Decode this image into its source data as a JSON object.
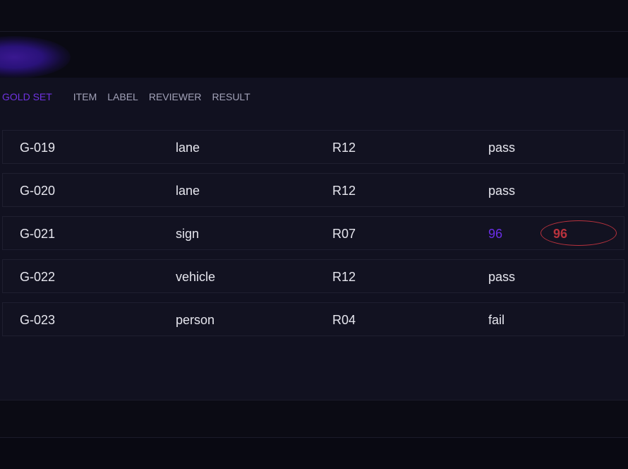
{
  "colors": {
    "accent": "#6f32e0",
    "score_highlight": "#b8323d",
    "background": "#090912",
    "panel": "#111120"
  },
  "panel": {
    "title": "GOLD SET",
    "columns": [
      "ITEM",
      "LABEL",
      "REVIEWER",
      "RESULT"
    ]
  },
  "rows": [
    {
      "item": "G-019",
      "label": "lane",
      "reviewer": "R12",
      "result": "pass"
    },
    {
      "item": "G-020",
      "label": "lane",
      "reviewer": "R12",
      "result": "pass"
    },
    {
      "item": "G-021",
      "label": "sign",
      "reviewer": "R07",
      "result": "96",
      "badge": "96"
    },
    {
      "item": "G-022",
      "label": "vehicle",
      "reviewer": "R12",
      "result": "pass"
    },
    {
      "item": "G-023",
      "label": "person",
      "reviewer": "R04",
      "result": "fail"
    }
  ]
}
